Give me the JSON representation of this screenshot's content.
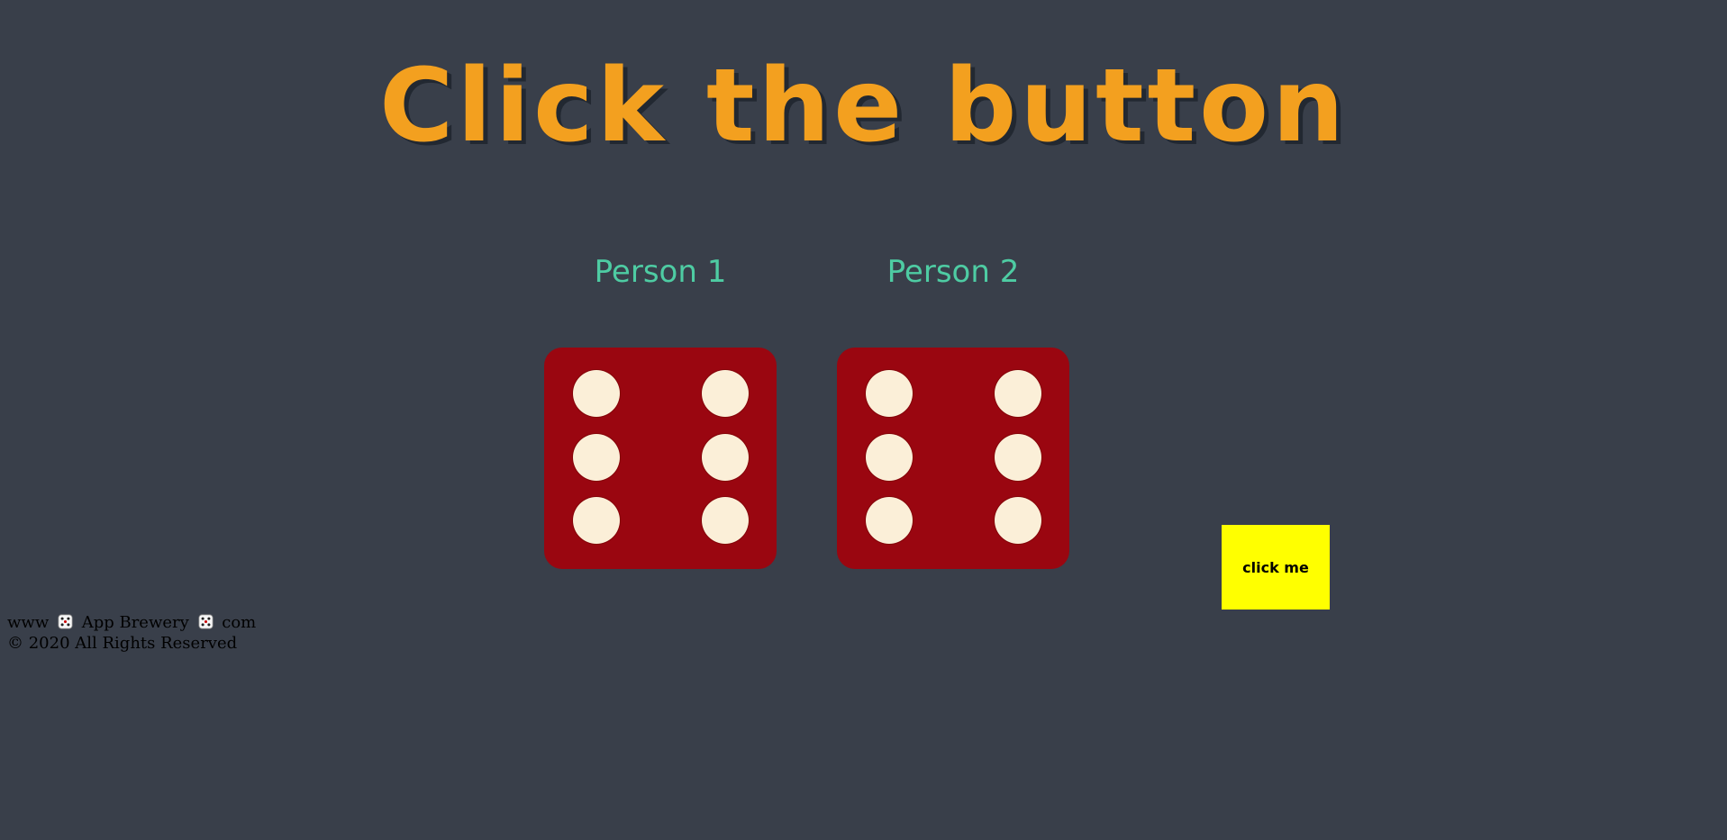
{
  "colors": {
    "background": "#393f4a",
    "title": "#f3a01f",
    "player_label": "#4ecca3",
    "die_body": "#9a0610",
    "die_pip": "#fbefd8",
    "button_bg": "#ffff00"
  },
  "header": {
    "title": "Click the button"
  },
  "players": [
    {
      "label": "Person 1",
      "die_value": 6
    },
    {
      "label": "Person 2",
      "die_value": 6
    }
  ],
  "button": {
    "label": "click me"
  },
  "footer": {
    "line1_part1": "www",
    "line1_part2": "App Brewery",
    "line1_part3": "com",
    "line2": "© 2020 All Rights Reserved",
    "separator_icon": "dice-icon"
  }
}
